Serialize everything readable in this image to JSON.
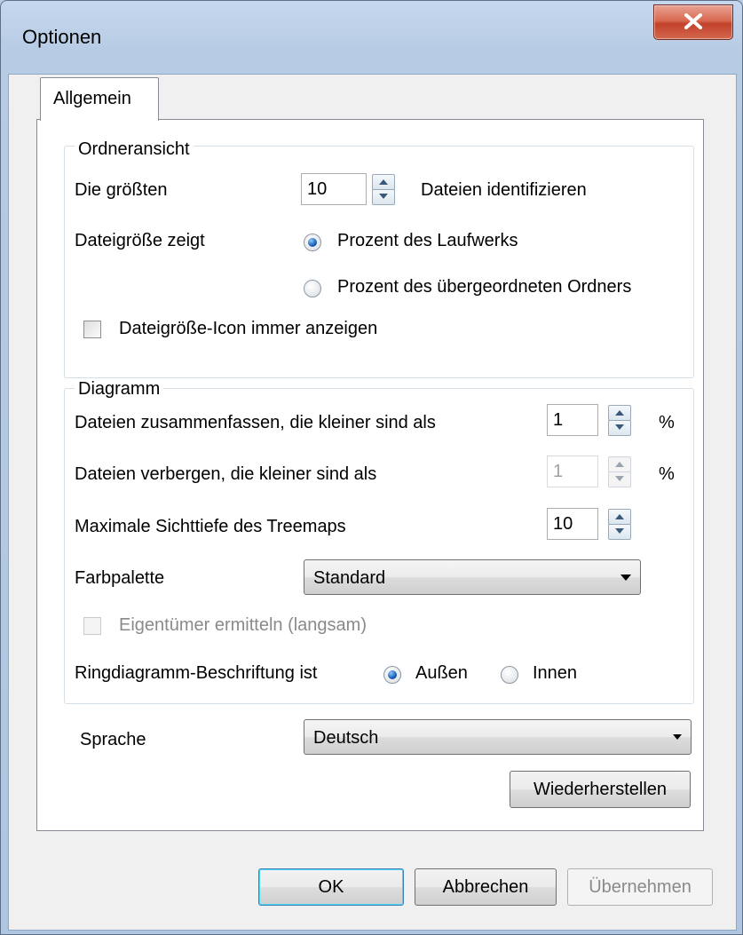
{
  "window": {
    "title": "Optionen"
  },
  "tabs": [
    {
      "label": "Allgemein"
    }
  ],
  "folder_view": {
    "title": "Ordneransicht",
    "identify_prefix": "Die größten",
    "identify_count": "10",
    "identify_suffix": "Dateien identifizieren",
    "filesize_shows_label": "Dateigröße zeigt",
    "radio_drive": "Prozent des Laufwerks",
    "radio_parent": "Prozent des übergeordneten Ordners",
    "selected_radio": "drive",
    "always_show_icon_label": "Dateigröße-Icon immer anzeigen",
    "always_show_icon_checked": false
  },
  "diagram": {
    "title": "Diagramm",
    "merge_label": "Dateien zusammenfassen, die kleiner sind als",
    "merge_value": "1",
    "merge_unit": "%",
    "hide_label": "Dateien verbergen, die kleiner sind als",
    "hide_value": "1",
    "hide_unit": "%",
    "depth_label": "Maximale Sichttiefe des Treemaps",
    "depth_value": "10",
    "palette_label": "Farbpalette",
    "palette_value": "Standard",
    "owner_label": "Eigentümer ermitteln (langsam)",
    "owner_checked": false,
    "ring_label": "Ringdiagramm-Beschriftung ist",
    "ring_outside": "Außen",
    "ring_inside": "Innen",
    "ring_selected": "outside"
  },
  "language": {
    "label": "Sprache",
    "value": "Deutsch"
  },
  "restore_button": "Wiederherstellen",
  "buttons": {
    "ok": "OK",
    "cancel": "Abbrechen",
    "apply": "Übernehmen"
  }
}
